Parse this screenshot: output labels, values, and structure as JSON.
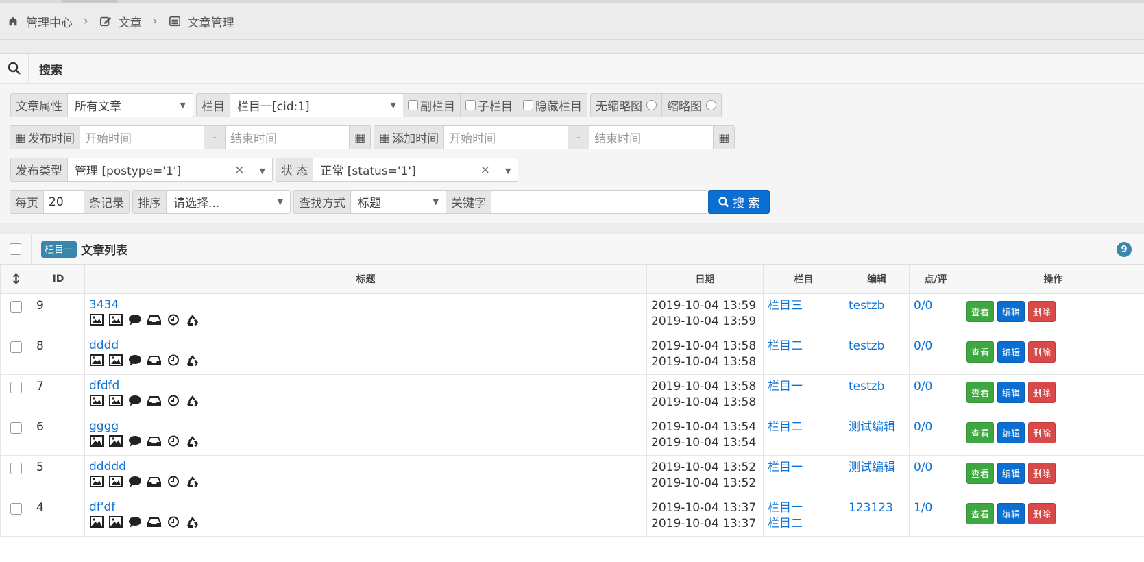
{
  "breadcrumb": {
    "home": "管理中心",
    "section": "文章",
    "current": "文章管理"
  },
  "search": {
    "title": "搜索",
    "article_attr_label": "文章属性",
    "article_attr_value": "所有文章",
    "column_label": "栏目",
    "column_value": "栏目一[cid:1]",
    "sub_column_label": "副栏目",
    "child_column_label": "子栏目",
    "hidden_column_label": "隐藏栏目",
    "no_thumb_label": "无缩略图",
    "thumb_label": "缩略图",
    "publish_time_label": "发布时间",
    "add_time_label": "添加时间",
    "start_placeholder": "开始时间",
    "end_placeholder": "结束时间",
    "range_sep": "-",
    "publish_type_label": "发布类型",
    "publish_type_value": "管理 [postype='1']",
    "status_label": "状 态",
    "status_value": "正常 [status='1']",
    "per_page_label": "每页",
    "per_page_value": "20",
    "records_label": "条记录",
    "sort_label": "排序",
    "sort_placeholder": "请选择...",
    "find_mode_label": "查找方式",
    "find_mode_value": "标题",
    "keyword_label": "关键字",
    "keyword_value": "",
    "search_button": "搜 索"
  },
  "list": {
    "tag": "栏目一",
    "title": "文章列表",
    "count": "9",
    "headers": [
      "ID",
      "标题",
      "日期",
      "栏目",
      "编辑",
      "点/评",
      "操作"
    ],
    "actions": {
      "view": "查看",
      "edit": "编辑",
      "delete": "删除"
    },
    "row_icons": [
      "image-icon",
      "image-icon",
      "comment-icon",
      "inbox-icon",
      "clock-icon",
      "recycle-icon"
    ],
    "rows": [
      {
        "id": "9",
        "title": "3434",
        "date1": "2019-10-04 13:59",
        "date2": "2019-10-04 13:59",
        "column1": "栏目三",
        "column2": "",
        "editor": "testzb",
        "stats": "0/0"
      },
      {
        "id": "8",
        "title": "dddd",
        "date1": "2019-10-04 13:58",
        "date2": "2019-10-04 13:58",
        "column1": "栏目二",
        "column2": "",
        "editor": "testzb",
        "stats": "0/0"
      },
      {
        "id": "7",
        "title": "dfdfd",
        "date1": "2019-10-04 13:58",
        "date2": "2019-10-04 13:58",
        "column1": "栏目一",
        "column2": "",
        "editor": "testzb",
        "stats": "0/0"
      },
      {
        "id": "6",
        "title": "gggg",
        "date1": "2019-10-04 13:54",
        "date2": "2019-10-04 13:54",
        "column1": "栏目二",
        "column2": "",
        "editor": "测试编辑",
        "stats": "0/0"
      },
      {
        "id": "5",
        "title": "ddddd",
        "date1": "2019-10-04 13:52",
        "date2": "2019-10-04 13:52",
        "column1": "栏目一",
        "column2": "",
        "editor": "测试编辑",
        "stats": "0/0"
      },
      {
        "id": "4",
        "title": "df'df",
        "date1": "2019-10-04 13:37",
        "date2": "2019-10-04 13:37",
        "column1": "栏目一",
        "column2": "栏目二",
        "editor": "123123",
        "stats": "1/0"
      }
    ]
  }
}
